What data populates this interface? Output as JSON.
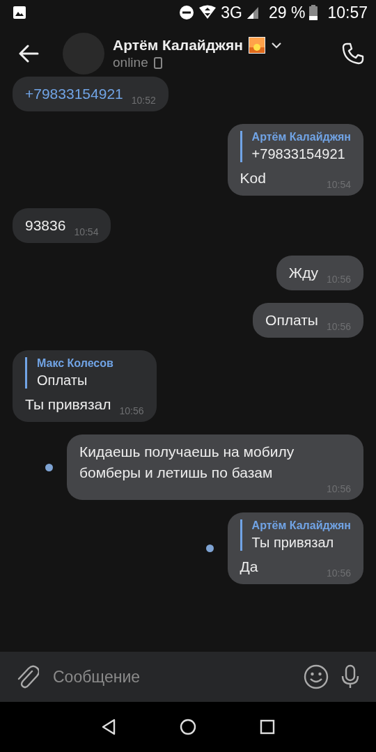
{
  "status_bar": {
    "network": "3G",
    "battery": "29 %",
    "time": "10:57"
  },
  "header": {
    "name": "Артём Калайджян",
    "status": "online"
  },
  "messages": [
    {
      "outgoing": false,
      "kind": "link",
      "text": "+79833154921",
      "time": "10:52",
      "unread": false
    },
    {
      "outgoing": true,
      "kind": "text",
      "reply": {
        "author": "Артём Калайджян",
        "text": "+79833154921"
      },
      "text": "Kod",
      "time": "10:54",
      "unread": false
    },
    {
      "outgoing": false,
      "kind": "text",
      "text": "93836",
      "time": "10:54",
      "unread": false
    },
    {
      "outgoing": true,
      "kind": "text",
      "text": "Жду",
      "time": "10:56",
      "unread": false
    },
    {
      "outgoing": true,
      "kind": "text",
      "text": "Оплаты",
      "time": "10:56",
      "unread": false
    },
    {
      "outgoing": false,
      "kind": "text",
      "reply": {
        "author": "Макс Колесов",
        "text": "Оплаты"
      },
      "text": "Ты привязал",
      "time": "10:56",
      "unread": false
    },
    {
      "outgoing": true,
      "kind": "text",
      "text": "Кидаешь получаешь на мобилу бомберы и летишь по базам",
      "time": "10:56",
      "unread": true
    },
    {
      "outgoing": true,
      "kind": "text",
      "reply": {
        "author": "Артём Калайджян",
        "text": "Ты привязал"
      },
      "text": "Да",
      "time": "10:56",
      "unread": true
    }
  ],
  "composer": {
    "placeholder": "Сообщение"
  }
}
